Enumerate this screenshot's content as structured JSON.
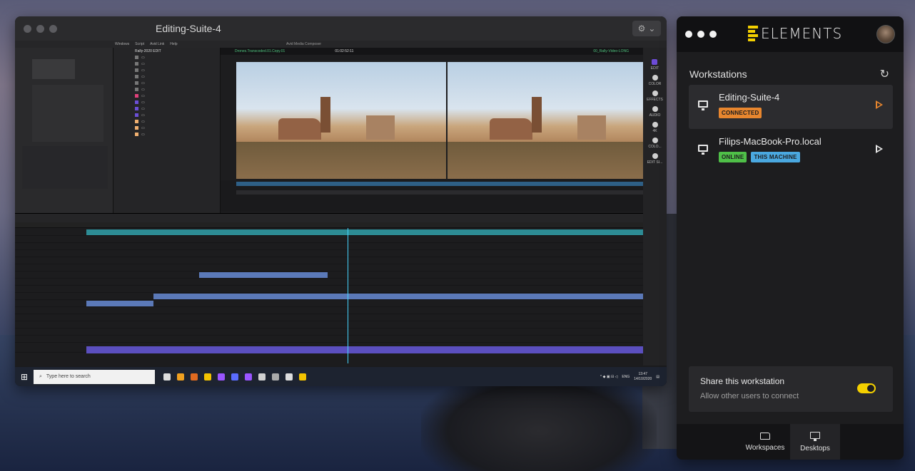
{
  "remote_window": {
    "title": "Editing-Suite-4",
    "avid": {
      "app_title": "Avid Media Composer",
      "menu": [
        "Windows",
        "Script",
        "Avid Link",
        "Help"
      ],
      "source_clip": "Drones.Transcoded.01.Copy.01",
      "record_clip": "00_Rally-Video-LONG",
      "bin_title": "Rally-2020 EDIT",
      "timeline_timecode": "01:02:52:11",
      "side_tools": [
        "EDIT",
        "COLOR",
        "EFFECTS",
        "AUDIO",
        "4K",
        "COLO...",
        "EDIT SI..."
      ]
    },
    "taskbar": {
      "search_placeholder": "Type here to search",
      "lang": "ENG",
      "time": "13:47",
      "date": "14/10/2020"
    }
  },
  "elements": {
    "brand": "ELEMENTS",
    "section_title": "Workstations",
    "refresh_icon": "refresh-icon",
    "workstations": [
      {
        "name": "Editing-Suite-4",
        "badges": [
          "CONNECTED"
        ],
        "active": true
      },
      {
        "name": "Filips-MacBook-Pro.local",
        "badges": [
          "ONLINE",
          "THIS MACHINE"
        ],
        "active": false
      }
    ],
    "share": {
      "title": "Share this workstation",
      "subtitle": "Allow other users to connect",
      "enabled": true
    },
    "nav": [
      {
        "label": "Workspaces",
        "icon": "folder-icon",
        "active": false
      },
      {
        "label": "Desktops",
        "icon": "monitor-icon",
        "active": true
      }
    ],
    "colors": {
      "accent": "#f4d000",
      "connected": "#e8862e",
      "online": "#4fbf48",
      "this_machine": "#4aa8e0"
    }
  }
}
